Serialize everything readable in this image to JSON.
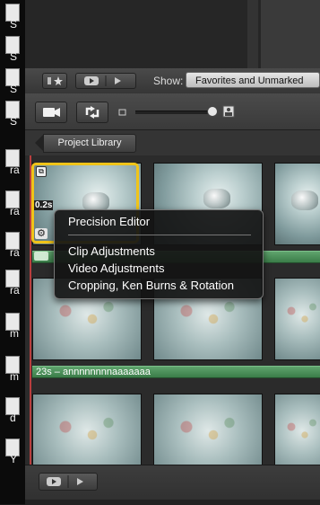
{
  "desktop": {
    "items": [
      {
        "label": "S"
      },
      {
        "label": "S"
      },
      {
        "label": "S"
      },
      {
        "label": "S"
      },
      {
        "label": "ra"
      },
      {
        "label": "ra"
      },
      {
        "label": "ra"
      },
      {
        "label": "ra"
      },
      {
        "label": "m"
      },
      {
        "label": "m"
      },
      {
        "label": "d"
      },
      {
        "label": "Y"
      }
    ]
  },
  "toolbar": {
    "show_label": "Show:",
    "show_value": "Favorites and Unmarked"
  },
  "project_library": {
    "label": "Project Library"
  },
  "clip": {
    "duration": "0.2s",
    "event_label": "23s – annnnnnnnaaaaaaa"
  },
  "context_menu": {
    "items": [
      "Precision Editor",
      "Clip Adjustments",
      "Video Adjustments",
      "Cropping, Ken Burns & Rotation"
    ]
  }
}
